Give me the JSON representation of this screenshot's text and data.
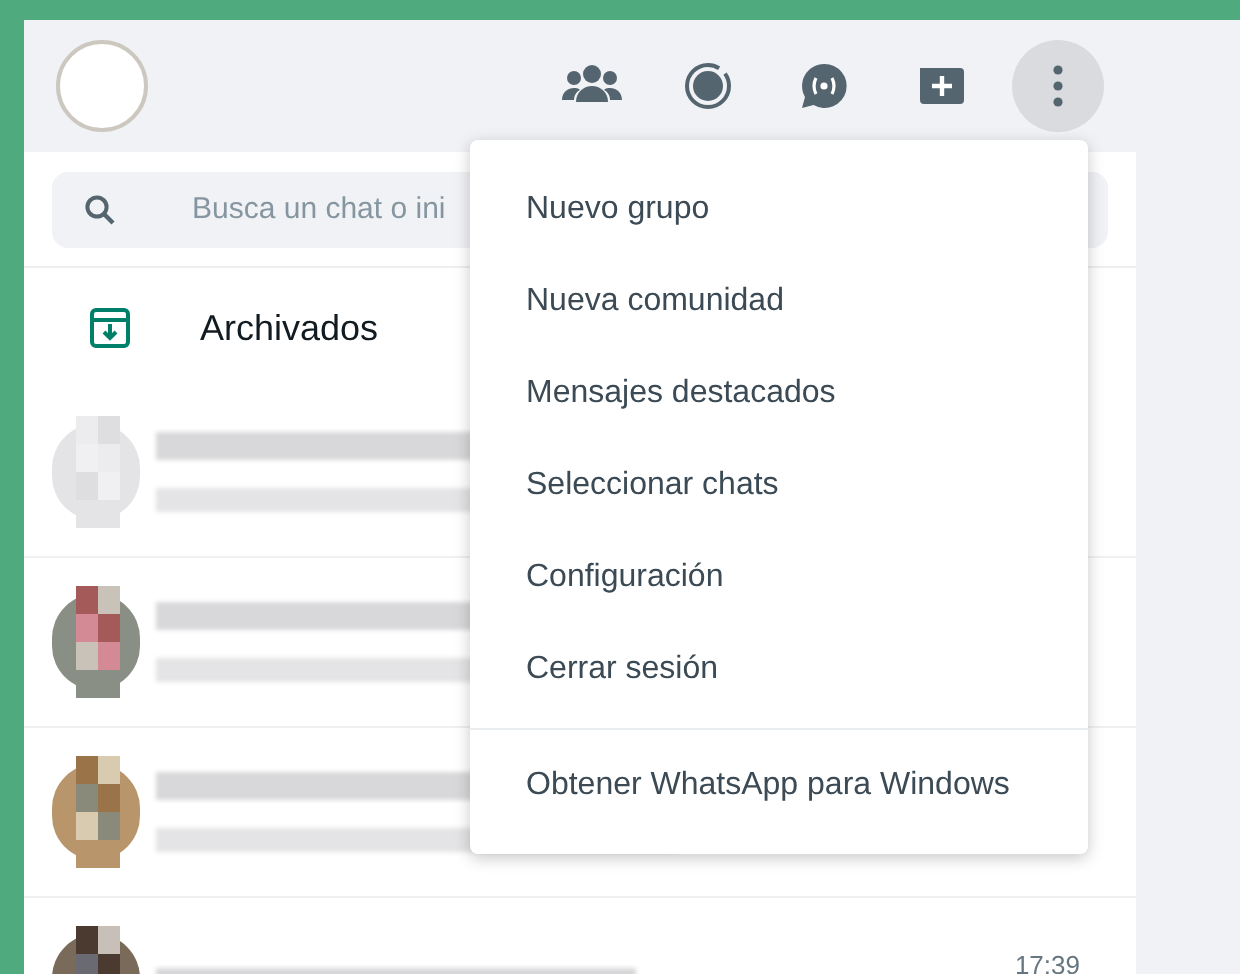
{
  "header": {
    "menu_open": true
  },
  "search": {
    "placeholder": "Busca un chat o ini"
  },
  "archived": {
    "label": "Archivados"
  },
  "chats": [
    {
      "kind": "chat"
    },
    {
      "kind": "chat"
    },
    {
      "kind": "chat"
    },
    {
      "kind": "partial",
      "time": "17:39"
    }
  ],
  "menu": {
    "items": [
      {
        "label": "Nuevo grupo",
        "kind": "item"
      },
      {
        "label": "Nueva comunidad",
        "kind": "item"
      },
      {
        "label": "Mensajes destacados",
        "kind": "item"
      },
      {
        "label": "Seleccionar chats",
        "kind": "item"
      },
      {
        "label": "Configuración",
        "kind": "item"
      },
      {
        "label": "Cerrar sesión",
        "kind": "item"
      },
      {
        "label": "Obtener WhatsApp para Windows",
        "kind": "footer"
      }
    ]
  }
}
